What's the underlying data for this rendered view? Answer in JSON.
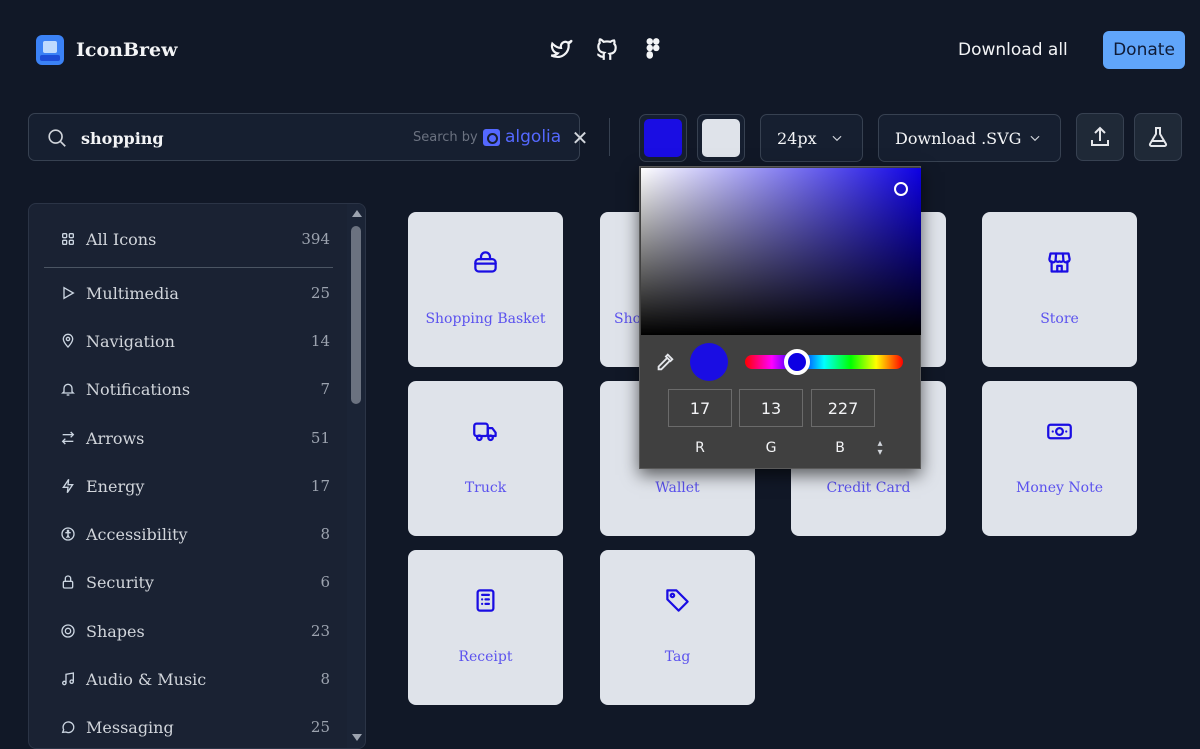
{
  "header": {
    "app_name": "IconBrew",
    "social": [
      "twitter-icon",
      "github-icon",
      "figma-icon"
    ],
    "download_all": "Download all",
    "donate": "Donate"
  },
  "toolbar": {
    "search_value": "shopping",
    "search_by": "Search by",
    "algolia": "algolia",
    "primary_color": "#1a0de3",
    "secondary_color": "#dfe3ea",
    "size": "24px",
    "download_format": "Download .SVG"
  },
  "sidebar": {
    "items": [
      {
        "label": "All Icons",
        "count": "394",
        "icon": "grid-icon"
      },
      {
        "label": "Multimedia",
        "count": "25",
        "icon": "play-icon"
      },
      {
        "label": "Navigation",
        "count": "14",
        "icon": "map-pin-icon"
      },
      {
        "label": "Notifications",
        "count": "7",
        "icon": "bell-icon"
      },
      {
        "label": "Arrows",
        "count": "51",
        "icon": "arrows-icon"
      },
      {
        "label": "Energy",
        "count": "17",
        "icon": "bolt-icon"
      },
      {
        "label": "Accessibility",
        "count": "8",
        "icon": "accessibility-icon"
      },
      {
        "label": "Security",
        "count": "6",
        "icon": "lock-icon"
      },
      {
        "label": "Shapes",
        "count": "23",
        "icon": "target-icon"
      },
      {
        "label": "Audio & Music",
        "count": "8",
        "icon": "music-note-icon"
      },
      {
        "label": "Messaging",
        "count": "25",
        "icon": "chat-bubble-icon"
      }
    ]
  },
  "icons": [
    {
      "label": "Shopping Basket",
      "icon": "basket-icon"
    },
    {
      "label": "Shop",
      "icon": "bag-icon"
    },
    {
      "label": "",
      "icon": "cart-icon"
    },
    {
      "label": "Store",
      "icon": "store-icon"
    },
    {
      "label": "Truck",
      "icon": "truck-icon"
    },
    {
      "label": "Wallet",
      "icon": "wallet-icon"
    },
    {
      "label": "Credit Card",
      "icon": "credit-card-icon"
    },
    {
      "label": "Money Note",
      "icon": "money-note-icon"
    },
    {
      "label": "Receipt",
      "icon": "receipt-icon"
    },
    {
      "label": "Tag",
      "icon": "tag-icon"
    }
  ],
  "color_picker": {
    "preview_color": "#1a0de3",
    "r": "17",
    "g": "13",
    "b": "227",
    "r_label": "R",
    "g_label": "G",
    "b_label": "B"
  }
}
